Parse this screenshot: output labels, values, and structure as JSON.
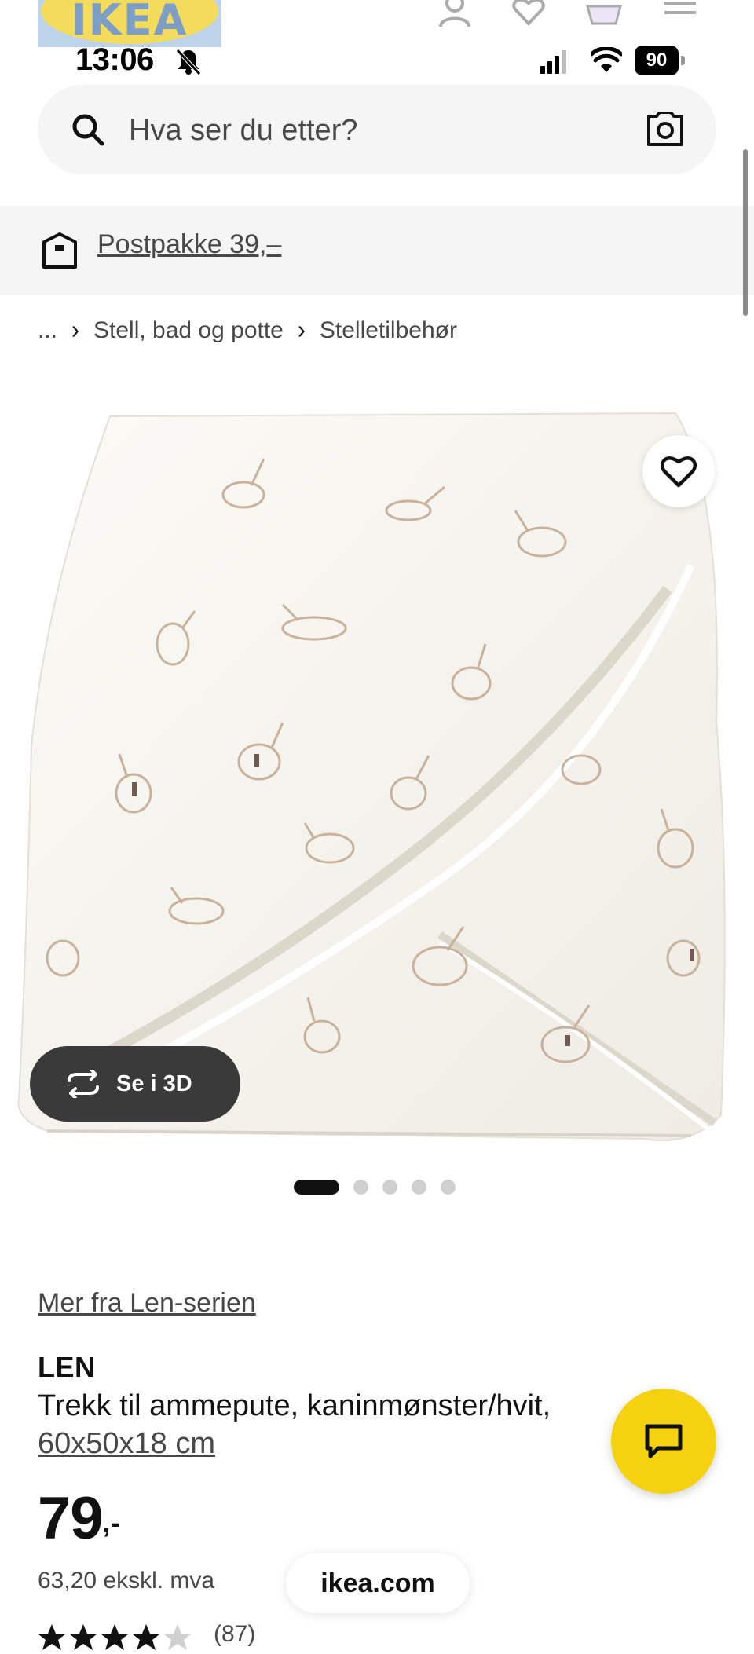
{
  "header": {
    "logo_text": "IKEA",
    "icons": [
      "user-icon",
      "heart-icon",
      "basket-icon",
      "menu-icon"
    ]
  },
  "status_bar": {
    "time": "13:06",
    "battery": "90"
  },
  "search": {
    "placeholder": "Hva ser du etter?"
  },
  "delivery_banner": {
    "label": "Postpakke 39,–"
  },
  "breadcrumb": {
    "ellipsis": "...",
    "items": [
      "Stell, bad og potte",
      "Stelletilbehør"
    ]
  },
  "gallery": {
    "view_3d_label": "Se i 3D",
    "image_count": 5,
    "active_index": 0
  },
  "product": {
    "series_link": "Mer fra Len-serien",
    "name": "LEN",
    "description": "Trekk til ammepute, kaninmønster/hvit,",
    "dimensions": "60x50x18 cm",
    "price_integer": "79",
    "price_suffix": ",-",
    "price_ex_vat": "63,20 ekskl. mva",
    "rating_count": "(87)"
  },
  "browser": {
    "url": "ikea.com"
  },
  "colors": {
    "ikea_yellow": "#f5d20f",
    "ikea_blue": "#0058a3",
    "text_gray": "#484848",
    "surface_gray": "#f5f5f5"
  }
}
